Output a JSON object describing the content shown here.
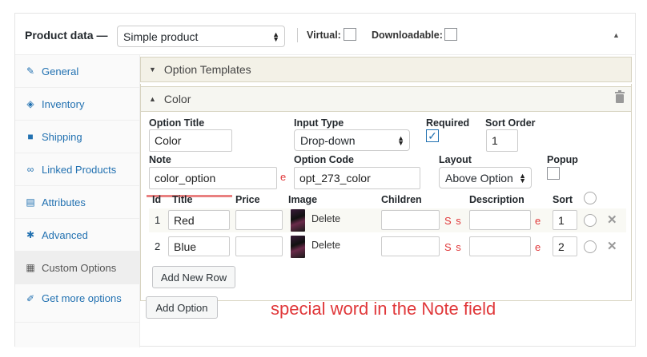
{
  "header": {
    "title": "Product data —",
    "product_type": "Simple product",
    "virtual_label": "Virtual:",
    "downloadable_label": "Downloadable:"
  },
  "sidebar": {
    "items": [
      {
        "label": "General",
        "icon": "wrench-icon"
      },
      {
        "label": "Inventory",
        "icon": "tag-icon"
      },
      {
        "label": "Shipping",
        "icon": "truck-icon"
      },
      {
        "label": "Linked Products",
        "icon": "link-icon"
      },
      {
        "label": "Attributes",
        "icon": "list-icon"
      },
      {
        "label": "Advanced",
        "icon": "gear-icon"
      },
      {
        "label": "Custom Options",
        "icon": "table-icon"
      },
      {
        "label": "Get more options",
        "icon": "pin-icon"
      }
    ]
  },
  "templates": {
    "label": "Option Templates"
  },
  "option": {
    "title": "Color",
    "labels": {
      "option_title": "Option Title",
      "input_type": "Input Type",
      "required": "Required",
      "sort_order": "Sort Order",
      "note": "Note",
      "option_code": "Option Code",
      "layout": "Layout",
      "popup": "Popup"
    },
    "values": {
      "option_title": "Color",
      "input_type": "Drop-down",
      "sort_order": "1",
      "note": "color_option",
      "option_code": "opt_273_color",
      "layout": "Above Option"
    },
    "marker_e": "e",
    "marker_s": "S s",
    "columns": [
      "Id",
      "Title",
      "Price",
      "Image",
      "Children",
      "Description",
      "Sort"
    ],
    "rows": [
      {
        "id": "1",
        "title": "Red",
        "sort": "1",
        "delete": "Delete"
      },
      {
        "id": "2",
        "title": "Blue",
        "sort": "2",
        "delete": "Delete"
      }
    ],
    "add_row": "Add New Row"
  },
  "add_option": "Add Option",
  "annotation": "special word in the Note field"
}
